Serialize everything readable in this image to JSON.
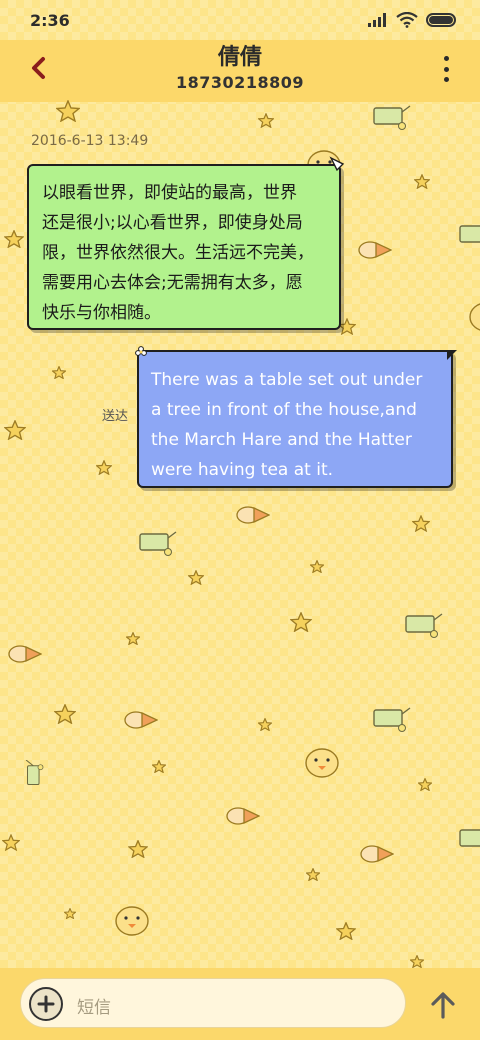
{
  "status_bar": {
    "time": "2:36"
  },
  "header": {
    "contact_name": "倩倩",
    "contact_number": "18730218809"
  },
  "conversation": {
    "timestamp": "2016-6-13 13:49",
    "messages": [
      {
        "direction": "incoming",
        "lines": [
          "以眼看世界，即使站的最高，世界",
          "还是很小;以心看世界，即使身处局",
          "限，世界依然很大。生活远不完美，",
          "需要用心去体会;无需拥有太多，愿",
          "快乐与你相随。"
        ]
      },
      {
        "direction": "outgoing",
        "lines": [
          "There was a table set out under",
          "a tree in front of the house,and",
          "the March Hare and the Hatter",
          "were having tea at it."
        ],
        "status": "送达"
      }
    ]
  },
  "composer": {
    "placeholder": "短信"
  },
  "icons": {
    "back": "chevron-left-icon",
    "more": "more-vertical-icon",
    "add": "plus-icon",
    "send": "arrow-up-icon"
  },
  "colors": {
    "background": "#fde58a",
    "header": "#fcd86a",
    "incoming_bubble": "#b2f28d",
    "outgoing_bubble": "#8da7f5"
  }
}
